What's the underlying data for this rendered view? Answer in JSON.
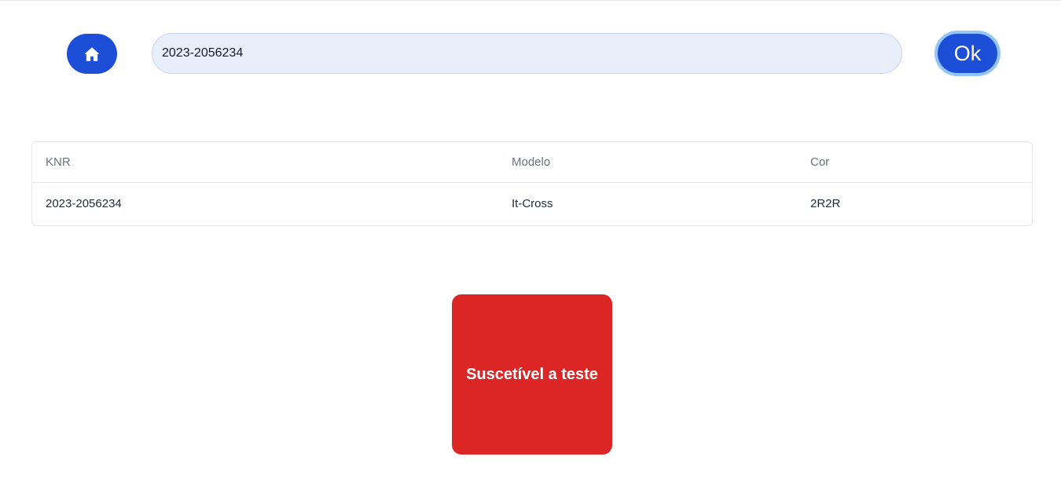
{
  "search": {
    "value": "2023-2056234",
    "ok_label": "Ok"
  },
  "icons": {
    "home": "home-icon"
  },
  "colors": {
    "primary": "#1d4ed8",
    "ok_ring": "#93c5fd",
    "input_bg": "#e8effb",
    "status_red": "#dc2626"
  },
  "table": {
    "headers": [
      "KNR",
      "Modelo",
      "Cor"
    ],
    "rows": [
      [
        "2023-2056234",
        "It-Cross",
        "2R2R"
      ]
    ]
  },
  "status": {
    "label": "Suscetível a teste"
  }
}
